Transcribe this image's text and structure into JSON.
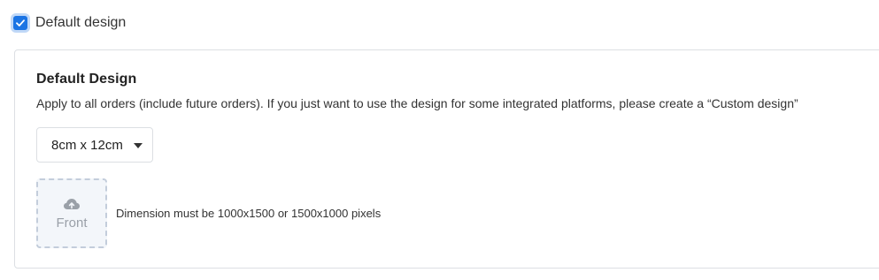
{
  "default_design": {
    "checkbox_label": "Default design",
    "checked": true
  },
  "panel": {
    "title": "Default Design",
    "description": "Apply to all orders (include future orders). If you just want to use the design for some integrated platforms, please create a “Custom design”",
    "size_select": {
      "selected": "8cm x 12cm"
    },
    "upload": {
      "icon": "cloud-upload-icon",
      "label": "Front"
    },
    "dimension_note": "Dimension must be 1000x1500 or 1500x1000 pixels"
  },
  "colors": {
    "accent": "#1b74e4",
    "border": "#dcdfe3",
    "upload_bg": "#f3f6fa",
    "upload_border": "#c3cddb",
    "muted_text": "#9aa0a8"
  }
}
